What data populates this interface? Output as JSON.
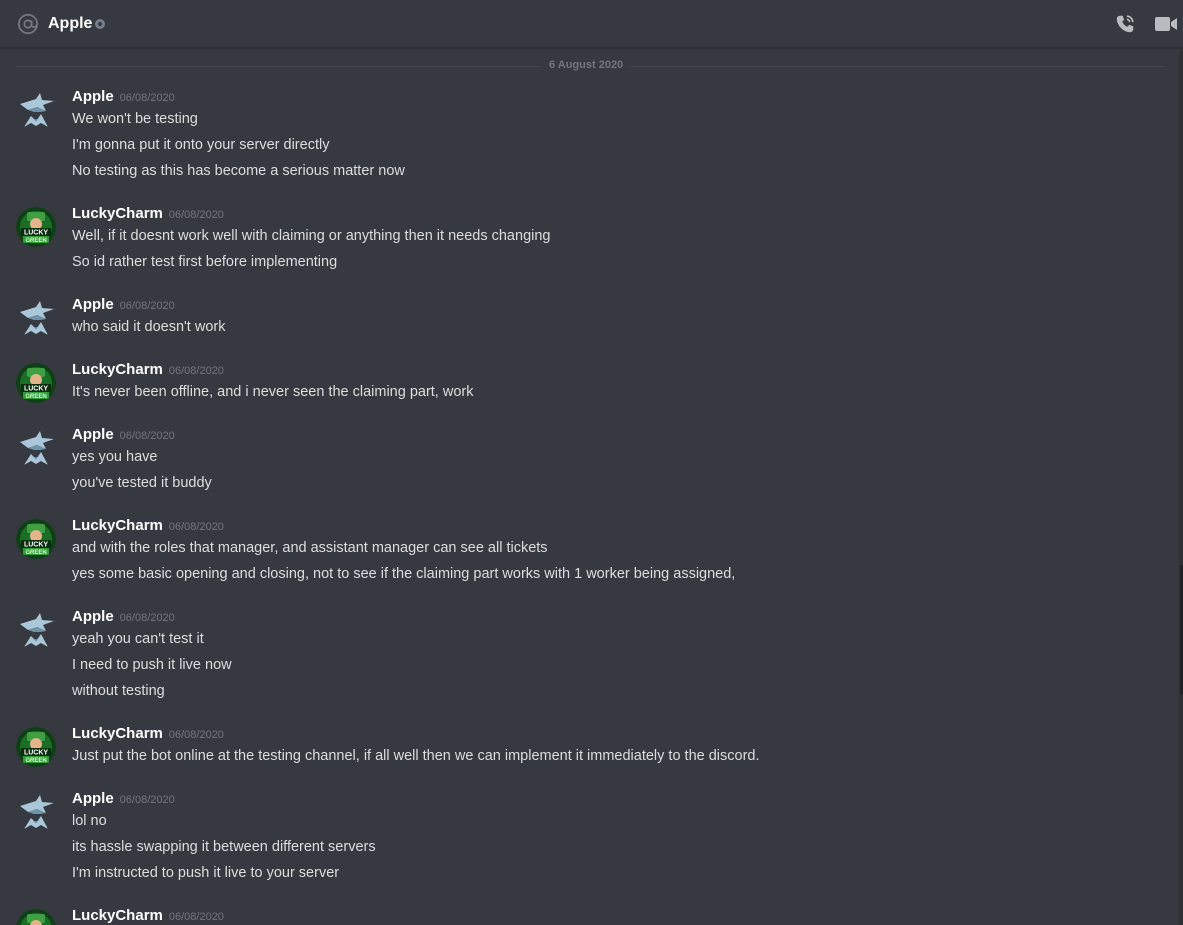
{
  "header": {
    "title": "Apple",
    "icons": {
      "at": "at-sign-icon",
      "status": "offline-status-icon",
      "call": "voice-call-icon",
      "video": "video-call-icon"
    }
  },
  "divider": {
    "label": "6 August 2020"
  },
  "colors": {
    "background": "#36393f",
    "author": "#ffffff",
    "text": "#dcddde",
    "muted": "#72767d",
    "lucky_green": "#1e8a2e"
  },
  "messages": [
    {
      "author": "Apple",
      "timestamp": "06/08/2020",
      "avatar": "apple-avatar",
      "lines": [
        "We won't be testing",
        "I'm gonna put it onto your server directly",
        "No testing as this has become a serious matter now"
      ]
    },
    {
      "author": "LuckyCharm",
      "timestamp": "06/08/2020",
      "avatar": "luckycharm-avatar",
      "lines": [
        "Well, if it doesnt work well with claiming or anything then it needs changing",
        "So id rather test first before implementing"
      ]
    },
    {
      "author": "Apple",
      "timestamp": "06/08/2020",
      "avatar": "apple-avatar",
      "lines": [
        "who said it doesn't work"
      ]
    },
    {
      "author": "LuckyCharm",
      "timestamp": "06/08/2020",
      "avatar": "luckycharm-avatar",
      "lines": [
        "It's never been offline, and i never seen the claiming part, work"
      ]
    },
    {
      "author": "Apple",
      "timestamp": "06/08/2020",
      "avatar": "apple-avatar",
      "lines": [
        "yes you have",
        "you've tested it buddy"
      ]
    },
    {
      "author": "LuckyCharm",
      "timestamp": "06/08/2020",
      "avatar": "luckycharm-avatar",
      "lines": [
        "and with the roles that manager, and assistant manager can see all tickets",
        "yes some basic opening and closing, not to see if the claiming part works with 1 worker being assigned,"
      ]
    },
    {
      "author": "Apple",
      "timestamp": "06/08/2020",
      "avatar": "apple-avatar",
      "lines": [
        "yeah you can't test it",
        "I need to push it live now",
        "without testing"
      ]
    },
    {
      "author": "LuckyCharm",
      "timestamp": "06/08/2020",
      "avatar": "luckycharm-avatar",
      "lines": [
        "Just put the bot online at the testing channel, if all well then we can implement it immediately to the discord."
      ]
    },
    {
      "author": "Apple",
      "timestamp": "06/08/2020",
      "avatar": "apple-avatar",
      "lines": [
        "lol no",
        "its hassle swapping it between different servers",
        "I'm instructed to push it live to your server"
      ]
    },
    {
      "author": "LuckyCharm",
      "timestamp": "06/08/2020",
      "avatar": "luckycharm-avatar",
      "lines": []
    }
  ]
}
